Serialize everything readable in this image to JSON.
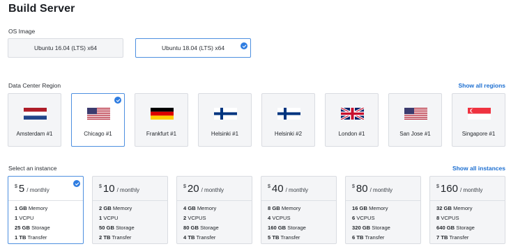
{
  "title": "Build Server",
  "os": {
    "label": "OS Image",
    "options": [
      {
        "label": "Ubuntu 16.04 (LTS) x64",
        "selected": false
      },
      {
        "label": "Ubuntu 18.04 (LTS) x64",
        "selected": true
      }
    ]
  },
  "regions": {
    "label": "Data Center Region",
    "show_all": "Show all regions",
    "items": [
      {
        "name": "Amsterdam #1",
        "flag": "netherlands-flag-icon",
        "selected": false
      },
      {
        "name": "Chicago #1",
        "flag": "usa-flag-icon",
        "selected": true
      },
      {
        "name": "Frankfurt #1",
        "flag": "germany-flag-icon",
        "selected": false
      },
      {
        "name": "Helsinki #1",
        "flag": "finland-flag-icon",
        "selected": false
      },
      {
        "name": "Helsinki #2",
        "flag": "finland-flag-icon",
        "selected": false
      },
      {
        "name": "London #1",
        "flag": "uk-flag-icon",
        "selected": false
      },
      {
        "name": "San Jose #1",
        "flag": "usa-flag-icon",
        "selected": false
      },
      {
        "name": "Singapore #1",
        "flag": "singapore-flag-icon",
        "selected": false
      }
    ]
  },
  "instances": {
    "label": "Select an instance",
    "show_all": "Show all instances",
    "currency": "$",
    "period": "/ monthly",
    "items": [
      {
        "price": "5",
        "selected": true,
        "specs": [
          {
            "val": "1 GB",
            "unit": "Memory"
          },
          {
            "val": "1",
            "unit": "VCPU"
          },
          {
            "val": "25 GB",
            "unit": "Storage"
          },
          {
            "val": "1 TB",
            "unit": "Transfer"
          }
        ]
      },
      {
        "price": "10",
        "selected": false,
        "specs": [
          {
            "val": "2 GB",
            "unit": "Memory"
          },
          {
            "val": "1",
            "unit": "VCPU"
          },
          {
            "val": "50 GB",
            "unit": "Storage"
          },
          {
            "val": "2 TB",
            "unit": "Transfer"
          }
        ]
      },
      {
        "price": "20",
        "selected": false,
        "specs": [
          {
            "val": "4 GB",
            "unit": "Memory"
          },
          {
            "val": "2",
            "unit": "VCPUS"
          },
          {
            "val": "80 GB",
            "unit": "Storage"
          },
          {
            "val": "4 TB",
            "unit": "Transfer"
          }
        ]
      },
      {
        "price": "40",
        "selected": false,
        "specs": [
          {
            "val": "8 GB",
            "unit": "Memory"
          },
          {
            "val": "4",
            "unit": "VCPUS"
          },
          {
            "val": "160 GB",
            "unit": "Storage"
          },
          {
            "val": "5 TB",
            "unit": "Transfer"
          }
        ]
      },
      {
        "price": "80",
        "selected": false,
        "specs": [
          {
            "val": "16 GB",
            "unit": "Memory"
          },
          {
            "val": "6",
            "unit": "VCPUS"
          },
          {
            "val": "320 GB",
            "unit": "Storage"
          },
          {
            "val": "6 TB",
            "unit": "Transfer"
          }
        ]
      },
      {
        "price": "160",
        "selected": false,
        "specs": [
          {
            "val": "32 GB",
            "unit": "Memory"
          },
          {
            "val": "8",
            "unit": "VCPUS"
          },
          {
            "val": "640 GB",
            "unit": "Storage"
          },
          {
            "val": "7 TB",
            "unit": "Transfer"
          }
        ]
      }
    ]
  },
  "colors": {
    "accent": "#2f7de1",
    "link": "#1d6fd1",
    "card_bg": "#f4f5f7",
    "card_border": "#d9dce1"
  }
}
